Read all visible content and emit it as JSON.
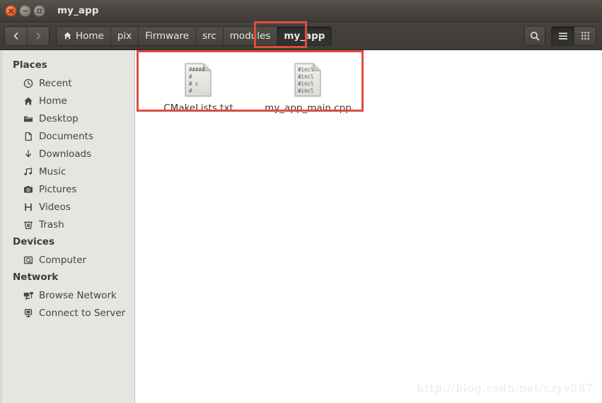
{
  "window": {
    "title": "my_app",
    "controls": [
      {
        "name": "close",
        "label": "Close"
      },
      {
        "name": "minimize",
        "label": "Minimize"
      },
      {
        "name": "maximize",
        "label": "Maximize"
      }
    ]
  },
  "toolbar": {
    "back_label": "Back",
    "forward_label": "Forward",
    "breadcrumbs": [
      {
        "label": "Home",
        "icon": "home-icon",
        "current": false
      },
      {
        "label": "pix",
        "icon": "",
        "current": false
      },
      {
        "label": "Firmware",
        "icon": "",
        "current": false
      },
      {
        "label": "src",
        "icon": "",
        "current": false
      },
      {
        "label": "modules",
        "icon": "",
        "current": false
      },
      {
        "label": "my_app",
        "icon": "",
        "current": true
      }
    ],
    "search_label": "Search",
    "list_view_label": "List view",
    "icon_view_label": "Icon view"
  },
  "sidebar": {
    "sections": [
      {
        "heading": "Places",
        "items": [
          {
            "label": "Recent",
            "icon": "clock-icon"
          },
          {
            "label": "Home",
            "icon": "home-icon"
          },
          {
            "label": "Desktop",
            "icon": "folder-icon"
          },
          {
            "label": "Documents",
            "icon": "document-icon"
          },
          {
            "label": "Downloads",
            "icon": "download-icon"
          },
          {
            "label": "Music",
            "icon": "music-icon"
          },
          {
            "label": "Pictures",
            "icon": "camera-icon"
          },
          {
            "label": "Videos",
            "icon": "film-icon"
          },
          {
            "label": "Trash",
            "icon": "trash-icon"
          }
        ]
      },
      {
        "heading": "Devices",
        "items": [
          {
            "label": "Computer",
            "icon": "computer-icon"
          }
        ]
      },
      {
        "heading": "Network",
        "items": [
          {
            "label": "Browse Network",
            "icon": "network-icon"
          },
          {
            "label": "Connect to Server",
            "icon": "server-icon"
          }
        ]
      }
    ]
  },
  "content": {
    "files": [
      {
        "label": "CMakeLists.txt",
        "icon": "text-file-icon",
        "preview": [
          "#####",
          "#",
          "#    c",
          "#"
        ]
      },
      {
        "label": "my_app_main.cpp",
        "icon": "source-file-icon",
        "preview": [
          "#incl",
          "#incl",
          "#incl",
          "#incl"
        ]
      }
    ]
  },
  "annotations": {
    "files_box_label": "file-selection-highlight",
    "breadcrumb_box_label": "current-folder-highlight",
    "color": "#e04b42"
  },
  "watermark": {
    "text": "http://blog.csdn.net/czyv587"
  }
}
